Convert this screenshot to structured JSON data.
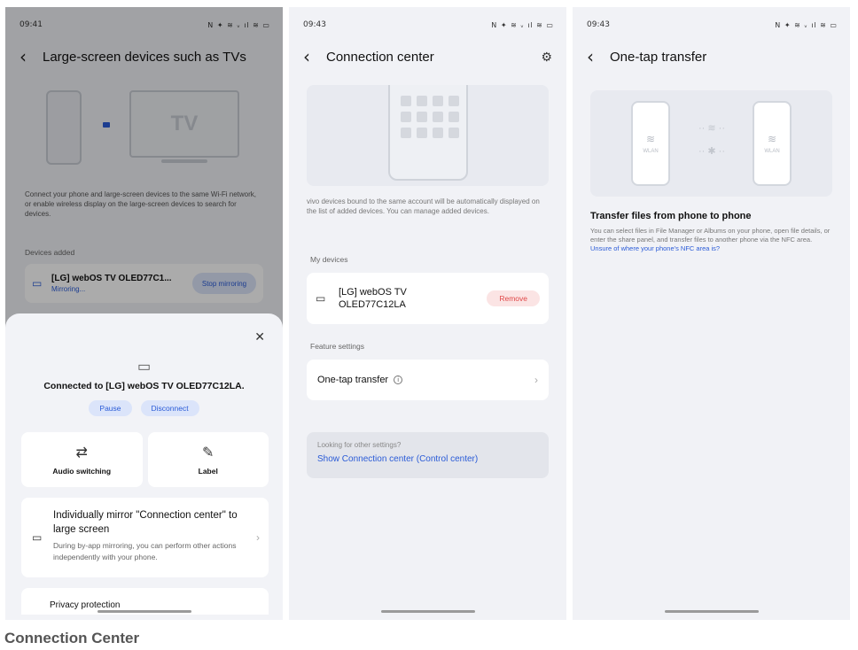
{
  "caption": "Connection Center",
  "screen1": {
    "status_time": "09:41",
    "status_right": "N ✦ ≋ ᵥ ıl ≋ ▭",
    "title": "Large-screen devices such as TVs",
    "tv_label": "TV",
    "description": "Connect your phone and large-screen devices to the same Wi-Fi network, or enable wireless display on the large-screen devices to search for devices.",
    "devices_added_label": "Devices added",
    "device_name": "[LG] webOS TV OLED77C1...",
    "device_status": "Mirroring...",
    "stop_button": "Stop mirroring",
    "sheet": {
      "connected_text": "Connected to [LG] webOS TV OLED77C12LA.",
      "pause": "Pause",
      "disconnect": "Disconnect",
      "audio_switching": "Audio switching",
      "label": "Label",
      "mirror_title": "Individually mirror \"Connection center\" to large screen",
      "mirror_sub": "During by-app mirroring, you can perform other actions independently with your phone.",
      "privacy": "Privacy protection"
    }
  },
  "screen2": {
    "status_time": "09:43",
    "status_right": "N ✦ ≋ ᵥ ıl ≋ ▭",
    "title": "Connection center",
    "description": "vivo devices bound to the same account will be automatically displayed on the list of added devices. You can manage added devices.",
    "my_devices_label": "My devices",
    "device_name": "[LG] webOS TV OLED77C12LA",
    "remove": "Remove",
    "feature_settings_label": "Feature settings",
    "one_tap_transfer": "One-tap transfer",
    "looking_for": "Looking for other settings?",
    "show_link": "Show Connection center (Control center)"
  },
  "screen3": {
    "status_time": "09:43",
    "status_right": "N ✦ ≋ ᵥ ıl ≋ ▭",
    "title": "One-tap transfer",
    "wlan_left": "WLAN",
    "wlan_right": "WLAN",
    "heading": "Transfer files from phone to phone",
    "description": "You can select files in File Manager or Albums on your phone, open file details, or enter the share panel, and transfer files to another phone via the NFC area.",
    "nfc_link": "Unsure of where your phone's NFC area is?"
  }
}
